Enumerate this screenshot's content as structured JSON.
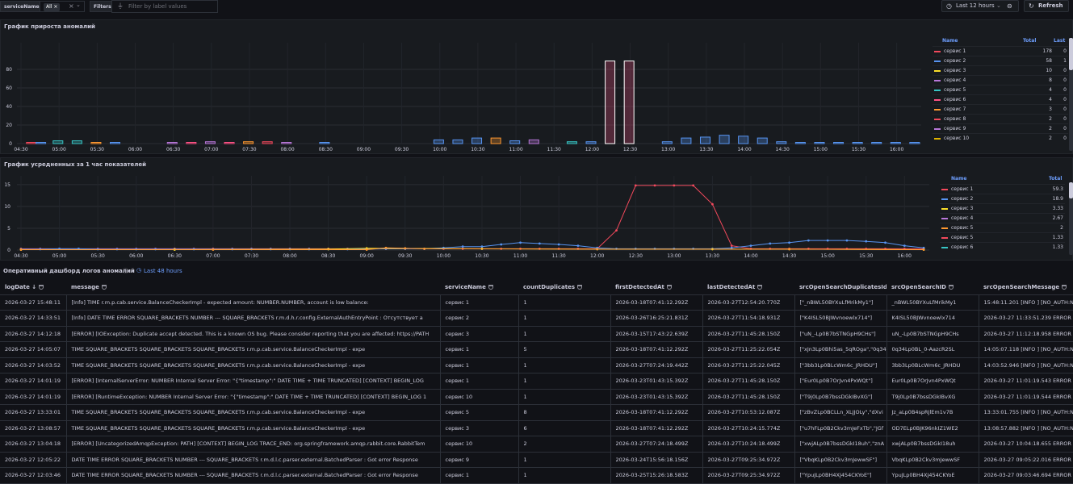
{
  "toolbar": {
    "var_label": "serviceName",
    "var_value": "All",
    "filters_label": "Filters",
    "filter_placeholder": "Filter by label values",
    "time_range": "Last 12 hours",
    "refresh_label": "Refresh"
  },
  "colors": {
    "background": "#111217",
    "panel": "#181b1f",
    "accent": "#6e9fff"
  },
  "panel1": {
    "title": "График прироста аномалий",
    "legend_headers": [
      "Name",
      "Total",
      "Last"
    ],
    "legend": [
      {
        "name": "сервис 1",
        "total": "178",
        "last": "0",
        "color": "#f2495c"
      },
      {
        "name": "сервис 2",
        "total": "58",
        "last": "1",
        "color": "#5794f2"
      },
      {
        "name": "сервис 3",
        "total": "10",
        "last": "0",
        "color": "#fade2a"
      },
      {
        "name": "сервис 4",
        "total": "8",
        "last": "0",
        "color": "#b877d9"
      },
      {
        "name": "сервис 5",
        "total": "4",
        "last": "0",
        "color": "#37c5c5"
      },
      {
        "name": "сервис 6",
        "total": "4",
        "last": "0",
        "color": "#ff5286"
      },
      {
        "name": "сервис 7",
        "total": "3",
        "last": "0",
        "color": "#ff9830"
      },
      {
        "name": "сервис 8",
        "total": "2",
        "last": "0",
        "color": "#f2495c"
      },
      {
        "name": "сервис 9",
        "total": "2",
        "last": "0",
        "color": "#b877d9"
      },
      {
        "name": "сервис 10",
        "total": "2",
        "last": "0",
        "color": "#e0b400"
      }
    ]
  },
  "panel2": {
    "title": "График усредненных за 1 час показателей",
    "legend_headers": [
      "Name",
      "Total"
    ],
    "legend": [
      {
        "name": "сервис 1",
        "total": "59.3",
        "color": "#f2495c"
      },
      {
        "name": "сервис 2",
        "total": "18.9",
        "color": "#5794f2"
      },
      {
        "name": "сервис 3",
        "total": "3.33",
        "color": "#fade2a"
      },
      {
        "name": "сервис 4",
        "total": "2.67",
        "color": "#b877d9"
      },
      {
        "name": "сервис 5",
        "total": "2",
        "color": "#ff9830"
      },
      {
        "name": "сервис 5",
        "total": "1.33",
        "color": "#f2495c"
      },
      {
        "name": "сервис 6",
        "total": "1.33",
        "color": "#37c5c5"
      }
    ]
  },
  "chart_data": [
    {
      "type": "bar",
      "title": "График прироста аномалий",
      "xlabel": "",
      "ylabel": "",
      "ylim": [
        0,
        100
      ],
      "yticks": [
        0,
        20,
        40,
        60,
        80
      ],
      "x_ticks": [
        "04:30",
        "05:00",
        "05:30",
        "06:00",
        "06:30",
        "07:00",
        "07:30",
        "08:00",
        "08:30",
        "09:00",
        "09:30",
        "10:00",
        "10:30",
        "11:00",
        "11:30",
        "12:00",
        "12:30",
        "13:00",
        "13:30",
        "14:00",
        "14:30",
        "15:00",
        "15:30",
        "16:00"
      ],
      "bars": [
        {
          "t": 0.5,
          "v": 1,
          "c": "#f2495c"
        },
        {
          "t": 1.0,
          "v": 1,
          "c": "#5794f2"
        },
        {
          "t": 1.9,
          "v": 3,
          "c": "#37c5c5"
        },
        {
          "t": 2.9,
          "v": 3,
          "c": "#37c5c5"
        },
        {
          "t": 3.9,
          "v": 1,
          "c": "#ff9830"
        },
        {
          "t": 4.9,
          "v": 1,
          "c": "#5794f2"
        },
        {
          "t": 7.9,
          "v": 1,
          "c": "#b877d9"
        },
        {
          "t": 8.9,
          "v": 1,
          "c": "#ff5286"
        },
        {
          "t": 9.9,
          "v": 2,
          "c": "#b877d9"
        },
        {
          "t": 10.9,
          "v": 1,
          "c": "#ff5286"
        },
        {
          "t": 11.9,
          "v": 2,
          "c": "#ff9830"
        },
        {
          "t": 12.9,
          "v": 2,
          "c": "#f2495c"
        },
        {
          "t": 13.9,
          "v": 1,
          "c": "#b877d9"
        },
        {
          "t": 15.9,
          "v": 1,
          "c": "#5794f2"
        },
        {
          "t": 21.9,
          "v": 4,
          "c": "#5794f2"
        },
        {
          "t": 22.9,
          "v": 4,
          "c": "#5794f2"
        },
        {
          "t": 23.9,
          "v": 6,
          "c": "#5794f2"
        },
        {
          "t": 24.9,
          "v": 6,
          "c": "#ff9830"
        },
        {
          "t": 25.9,
          "v": 3,
          "c": "#5794f2"
        },
        {
          "t": 26.9,
          "v": 4,
          "c": "#b877d9"
        },
        {
          "t": 28.9,
          "v": 2,
          "c": "#37c5c5"
        },
        {
          "t": 29.9,
          "v": 2,
          "c": "#5794f2"
        },
        {
          "t": 30.9,
          "v": 89,
          "c": "#ff5286"
        },
        {
          "t": 31.9,
          "v": 89,
          "c": "#ff5286"
        },
        {
          "t": 33.9,
          "v": 2,
          "c": "#5794f2"
        },
        {
          "t": 34.9,
          "v": 6,
          "c": "#5794f2"
        },
        {
          "t": 35.9,
          "v": 7,
          "c": "#5794f2"
        },
        {
          "t": 36.9,
          "v": 9,
          "c": "#5794f2"
        },
        {
          "t": 37.9,
          "v": 8,
          "c": "#5794f2"
        },
        {
          "t": 38.9,
          "v": 6,
          "c": "#5794f2"
        },
        {
          "t": 39.9,
          "v": 2,
          "c": "#5794f2"
        },
        {
          "t": 40.9,
          "v": 1,
          "c": "#5794f2"
        },
        {
          "t": 41.9,
          "v": 1,
          "c": "#5794f2"
        },
        {
          "t": 42.9,
          "v": 1,
          "c": "#5794f2"
        },
        {
          "t": 43.9,
          "v": 1,
          "c": "#5794f2"
        },
        {
          "t": 44.9,
          "v": 1,
          "c": "#5794f2"
        },
        {
          "t": 45.9,
          "v": 1,
          "c": "#5794f2"
        },
        {
          "t": 46.9,
          "v": 1,
          "c": "#5794f2"
        }
      ]
    },
    {
      "type": "line",
      "title": "График усредненных за 1 час показателей",
      "xlabel": "",
      "ylabel": "",
      "ylim": [
        0,
        17
      ],
      "yticks": [
        0,
        5,
        10,
        15
      ],
      "x_ticks": [
        "04:30",
        "05:00",
        "05:30",
        "06:00",
        "06:30",
        "07:00",
        "07:30",
        "08:00",
        "08:30",
        "09:00",
        "09:30",
        "10:00",
        "10:30",
        "11:00",
        "11:30",
        "12:00",
        "12:30",
        "13:00",
        "13:30",
        "14:00",
        "14:30",
        "15:00",
        "15:30",
        "16:00"
      ],
      "series": [
        {
          "name": "сервис 1",
          "color": "#f2495c",
          "t": [
            0,
            1,
            2,
            3,
            4,
            5,
            6,
            7,
            8,
            9,
            10,
            11,
            12,
            13,
            14,
            15,
            16,
            17,
            18,
            19,
            20,
            21,
            22,
            23,
            24,
            25,
            26,
            27,
            28,
            29,
            30,
            31,
            32,
            33,
            34,
            35,
            36,
            37,
            38,
            39,
            40,
            41,
            42,
            43,
            44,
            45,
            46,
            47
          ],
          "v": [
            0.3,
            0.3,
            0.3,
            0.3,
            0.3,
            0.3,
            0.3,
            0.3,
            0.3,
            0.3,
            0.3,
            0.3,
            0.3,
            0.3,
            0.3,
            0.3,
            0.3,
            0.3,
            0.3,
            0.3,
            0.3,
            0.3,
            0.3,
            0.3,
            0.3,
            0.3,
            0.3,
            0.3,
            0.3,
            0.3,
            0.3,
            4.5,
            14.8,
            14.8,
            14.8,
            14.8,
            10.5,
            1.0,
            0.3,
            0.3,
            0.3,
            0.3,
            0.3,
            0.3,
            0.3,
            0.3,
            0.3,
            0.3
          ]
        },
        {
          "name": "сервис 2",
          "color": "#5794f2",
          "t": [
            0,
            1,
            2,
            3,
            4,
            5,
            6,
            7,
            8,
            9,
            10,
            11,
            12,
            13,
            14,
            15,
            16,
            17,
            18,
            19,
            20,
            21,
            22,
            23,
            24,
            25,
            26,
            27,
            28,
            29,
            30,
            31,
            32,
            33,
            34,
            35,
            36,
            37,
            38,
            39,
            40,
            41,
            42,
            43,
            44,
            45,
            46,
            47
          ],
          "v": [
            0.2,
            0.2,
            0.3,
            0.3,
            0.2,
            0.2,
            0.2,
            0.2,
            0.2,
            0.2,
            0.2,
            0.2,
            0.2,
            0.2,
            0.2,
            0.2,
            0.2,
            0.2,
            0.2,
            0.3,
            0.3,
            0.3,
            0.5,
            0.8,
            0.8,
            1.3,
            1.7,
            1.5,
            1.3,
            1.0,
            0.5,
            0.3,
            0.3,
            0.3,
            0.3,
            0.3,
            0.3,
            0.5,
            1.0,
            1.5,
            1.7,
            2.2,
            2.2,
            2.2,
            2.0,
            1.7,
            1.0,
            0.5
          ]
        },
        {
          "name": "сервис 3",
          "color": "#fade2a",
          "t": [
            0,
            8,
            16,
            18,
            24,
            30,
            36,
            40,
            47
          ],
          "v": [
            0.1,
            0.1,
            0.2,
            0.4,
            0.3,
            0.2,
            0.2,
            0.2,
            0.1
          ]
        },
        {
          "name": "сервис 5",
          "color": "#ff9830",
          "t": [
            0,
            10,
            18,
            19,
            20,
            21,
            30,
            40,
            47
          ],
          "v": [
            0.1,
            0.1,
            0.1,
            0.5,
            0.4,
            0.3,
            0.2,
            0.2,
            0.1
          ]
        }
      ]
    }
  ],
  "logs": {
    "section_title": "Оперативный дашборд логов аномалий",
    "time_link": "Last 48 hours",
    "columns": [
      "logDate",
      "message",
      "serviceName",
      "countDuplicates",
      "firstDetectedAt",
      "lastDetectedAt",
      "srcOpenSearchDuplicatesIds",
      "srcOpenSearchID",
      "srcOpenSearchMessage"
    ],
    "rows": [
      [
        "2026-03-27 15:48:11",
        "[Info] TIME r.m.p.cab.service.BalanceCheckerImpl - expected amount: NUMBER.NUMBER, account is low balance:",
        "сервис 1",
        "1",
        "2026-03-18T07:41:12.292Z",
        "2026-03-27T12:54:20.770Z",
        "[\"_nBWL50BYXuLfMrikMy1\"]",
        "_nBWL50BYXuLfMrikMy1",
        "15:48:11.201 [INFO ] [NO_AUTH:NO"
      ],
      [
        "2026-03-27 14:33:51",
        "[Info] DATE TIME ERROR SQUARE_BRACKETS NUMBER --- SQUARE_BRACKETS r.m.d.h.r.config.ExternalAuthEntryPoint : Отсутствует а",
        "сервис 2",
        "1",
        "2026-03-26T16:25:21.831Z",
        "2026-03-27T11:54:18.931Z",
        "[\"K4ISL50BJWvnoewlx714\"]",
        "K4ISL50BJWvnoewlx714",
        "2026-03-27 11:33:51.239 ERROR"
      ],
      [
        "2026-03-27 14:12:18",
        "[ERROR] [IOException: Duplicate accept detected. This is a known OS bug. Please consider reporting that you are affected: https://PATH",
        "сервис 3",
        "1",
        "2026-03-15T17:43:22.639Z",
        "2026-03-27T11:45:28.150Z",
        "[\"uN_-Lp0B7bSTNGpH9CHs\"]",
        "uN_-Lp0B7bSTNGpH9CHs",
        "2026-03-27 11:12:18.958 ERROR"
      ],
      [
        "2026-03-27 14:05:07",
        "TIME SQUARE_BRACKETS SQUARE_BRACKETS SQUARE_BRACKETS r.m.p.cab.service.BalanceCheckerImpl - expe",
        "сервис 1",
        "5",
        "2026-03-18T07:41:12.292Z",
        "2026-03-27T11:25:22.054Z",
        "[\"xJn3Lp0Bhi5as_5qROga\",\"0q34",
        "0q34Lp0BL_0-AazcR2SL",
        "14:05:07.118 [INFO ] [NO_AUTH:NO"
      ],
      [
        "2026-03-27 14:03:52",
        "TIME SQUARE_BRACKETS SQUARE_BRACKETS SQUARE_BRACKETS r.m.p.cab.service.BalanceCheckerImpl - expe",
        "сервис 1",
        "1",
        "2026-03-27T07:24:19.442Z",
        "2026-03-27T11:25:22.045Z",
        "[\"3bb3Lp0BLcWm6c_JRHDU\"]",
        "3bb3Lp0BLcWm6c_JRHDU",
        "14:03:52.946 [INFO ] [NO_AUTH:NO"
      ],
      [
        "2026-03-27 14:01:19",
        "[ERROR] [InternalServerError: NUMBER Internal Server Error: \"{\"timestamp\":\" DATE TIME + TIME TRUNCATED] [CONTEXT] BEGIN_LOG",
        "сервис 1",
        "1",
        "2026-03-23T01:43:15.392Z",
        "2026-03-27T11:45:28.150Z",
        "[\"Eur0Lp0B7OrJvn4PxWQt\"]",
        "Eur0Lp0B7OrJvn4PxWQt",
        "2026-03-27 11:01:19.543 ERROR"
      ],
      [
        "2026-03-27 14:01:19",
        "[ERROR] [RuntimeException: NUMBER Internal Server Error: \"{\"timestamp\":\" DATE TIME + TIME TRUNCATED] [CONTEXT] BEGIN_LOG 1",
        "сервис 10",
        "1",
        "2026-03-23T01:43:15.392Z",
        "2026-03-27T11:45:28.150Z",
        "[\"T9j0Lp0B7bssDGkIBvXG\"]",
        "T9j0Lp0B7bssDGkIBvXG",
        "2026-03-27 11:01:19.544 ERROR"
      ],
      [
        "2026-03-27 13:33:01",
        "TIME SQUARE_BRACKETS SQUARE_BRACKETS SQUARE_BRACKETS r.m.p.cab.service.BalanceCheckerImpl - expe",
        "сервис 5",
        "8",
        "2026-03-18T07:41:12.292Z",
        "2026-03-27T10:53:12.087Z",
        "[\"zBvZLp0BCLLn_XLJJOLy\",\"dXvi",
        "Jz_aLp0B4spRJlEm1v7B",
        "13:33:01.755 [INFO ] [NO_AUTH:NO"
      ],
      [
        "2026-03-27 13:08:57",
        "TIME SQUARE_BRACKETS SQUARE_BRACKETS SQUARE_BRACKETS r.m.p.cab.service.BalanceCheckerImpl - expe",
        "сервис 3",
        "6",
        "2026-03-18T07:41:12.292Z",
        "2026-03-27T10:24:15.774Z",
        "[\"u7hFLp0B2Ckv3mJeFxTb\",\"JGf",
        "OD7ELp0BJK96nkIZ1WE2",
        "13:08:57.882 [INFO ] [NO_AUTH:NO"
      ],
      [
        "2026-03-27 13:04:18",
        "[ERROR] [UncategorizedAmqpException: PATH] [CONTEXT] BEGIN_LOG TRACE_END: org.springframework.amqp.rabbit.core.RabbitTem",
        "сервис 10",
        "2",
        "2026-03-27T07:24:18.499Z",
        "2026-03-27T10:24:18.499Z",
        "[\"xwjALp0B7bssDGkI18uh\",\"znA",
        "xwjALp0B7bssDGkI18uh",
        "2026-03-27 10:04:18.655 ERROR"
      ],
      [
        "2026-03-27 12:05:22",
        "DATE TIME ERROR SQUARE_BRACKETS NUMBER --- SQUARE_BRACKETS r.m.d.l.c.parser.external.BatchedParser : Got error Response",
        "сервис 9",
        "1",
        "2026-03-24T15:56:18.156Z",
        "2026-03-27T09:25:34.972Z",
        "[\"VbqKLp0B2Ckv3mJewwSF\"]",
        "VbqKLp0B2Ckv3mJewwSF",
        "2026-03-27 09:05:22.016 ERROR"
      ],
      [
        "2026-03-27 12:03:46",
        "DATE TIME ERROR SQUARE_BRACKETS NUMBER --- SQUARE_BRACKETS r.m.d.l.c.parser.external.BatchedParser : Got error Response",
        "сервис 1",
        "1",
        "2026-03-25T15:26:18.583Z",
        "2026-03-27T09:25:34.972Z",
        "[\"YpuJLp0BH4XJ454CKYoE\"]",
        "YpuJLp0BH4XJ454CKYoE",
        "2026-03-27 09:03:46.694 ERROR"
      ]
    ]
  }
}
